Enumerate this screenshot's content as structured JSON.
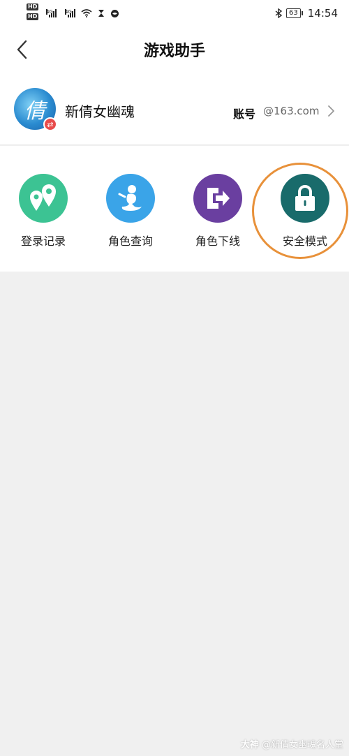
{
  "status_bar": {
    "hd1": "HD",
    "hd2": "HD",
    "sig1_label": "4G",
    "sig2_label": "4G",
    "battery": "63",
    "time": "14:54"
  },
  "nav": {
    "title": "游戏助手"
  },
  "account": {
    "game_name": "新倩女幽魂",
    "avatar_glyph": "倩",
    "swap_symbol": "⇄",
    "account_label": "账号",
    "account_value": "@163.com"
  },
  "tools": [
    {
      "label": "登录记录",
      "icon": "location-pins-icon",
      "color": "#3cc393"
    },
    {
      "label": "角色查询",
      "icon": "character-icon",
      "color": "#3aa4e8"
    },
    {
      "label": "角色下线",
      "icon": "logout-icon",
      "color": "#6a3fa0"
    },
    {
      "label": "安全模式",
      "icon": "lock-icon",
      "color": "#196b6b"
    }
  ],
  "highlight_color": "#e8913a",
  "watermark": {
    "brand": "大神",
    "text": "@新倩女幽魂名人堂"
  }
}
